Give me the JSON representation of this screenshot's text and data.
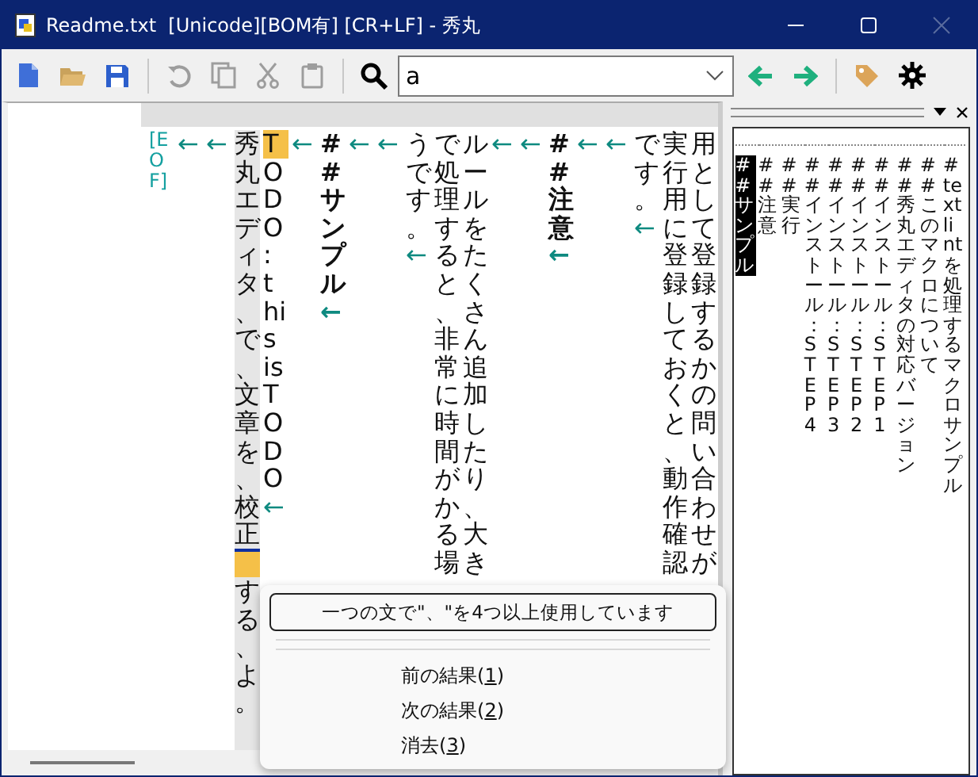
{
  "window": {
    "title": "Readme.txt  [Unicode][BOM有] [CR+LF] - 秀丸",
    "close_disabled": true
  },
  "toolbar": {
    "file_buttons": [
      {
        "kind": "new",
        "disabled": false
      },
      {
        "kind": "open",
        "disabled": false
      },
      {
        "kind": "save",
        "disabled": false
      }
    ],
    "edit_buttons": [
      {
        "kind": "undo",
        "disabled": true
      },
      {
        "kind": "copy",
        "disabled": true
      },
      {
        "kind": "cut",
        "disabled": true
      },
      {
        "kind": "paste",
        "disabled": true
      }
    ],
    "search": {
      "value": "a"
    },
    "nav_buttons": [
      {
        "kind": "back",
        "disabled": false
      },
      {
        "kind": "forward",
        "disabled": false
      }
    ],
    "tool_buttons": [
      {
        "kind": "tag",
        "disabled": false
      },
      {
        "kind": "settings",
        "disabled": false
      }
    ]
  },
  "editor": {
    "lines": [
      {
        "segments": [
          {
            "kind": "eof",
            "text": "[EOF]"
          }
        ]
      },
      {
        "eol": "←"
      },
      {
        "eol": "←"
      },
      {
        "segments": [
          {
            "kind": "text",
            "text": "秀丸エディタ、で、文章を、校正"
          },
          {
            "kind": "cursor"
          },
          {
            "kind": "text",
            "text": "する、"
          },
          {
            "kind": "text",
            "text": "よ。"
          }
        ],
        "current": true
      },
      {
        "segments": [
          {
            "kind": "mark",
            "text": "T"
          },
          {
            "kind": "text",
            "text": "ODO: this is TODO"
          }
        ],
        "eol": "←"
      },
      {
        "eol": "←"
      },
      {
        "segments": [
          {
            "kind": "text",
            "text": "## サンプル"
          }
        ],
        "bold": true,
        "eol": "←"
      },
      {
        "eol": "←"
      },
      {
        "eol": "←"
      },
      {
        "segments": [
          {
            "kind": "text",
            "text": "うです。"
          }
        ],
        "eol": "←"
      },
      {
        "segments": [
          {
            "kind": "text",
            "text": "で処理すると、非常に時間がかる場"
          }
        ]
      },
      {
        "segments": [
          {
            "kind": "text",
            "text": "ルールをたくさん追加したり、大き"
          }
        ]
      },
      {
        "eol": "←"
      },
      {
        "eol": "←"
      },
      {
        "segments": [
          {
            "kind": "text",
            "text": "## 注意"
          }
        ],
        "bold": true,
        "eol": "←"
      },
      {
        "eol": "←"
      },
      {
        "eol": "←"
      },
      {
        "segments": [
          {
            "kind": "text",
            "text": "です。"
          }
        ],
        "eol": "←"
      },
      {
        "segments": [
          {
            "kind": "text",
            "text": "実行用に登録しておくと、動作確認"
          }
        ]
      },
      {
        "segments": [
          {
            "kind": "text",
            "text": "用として登録するかの問い合わせが"
          }
        ]
      }
    ]
  },
  "outline": {
    "items": [
      {
        "label": "# textlintを処理するマクロサンプル",
        "selected": false,
        "children": [
          {
            "label": "## サンプル",
            "selected": true
          },
          {
            "label": "## 注意",
            "selected": false
          },
          {
            "label": "## 実行",
            "selected": false
          },
          {
            "label": "## インストール：STEP 4",
            "selected": false
          },
          {
            "label": "## インストール：STEP 3",
            "selected": false
          },
          {
            "label": "## インストール：STEP 2",
            "selected": false
          },
          {
            "label": "## インストール：STEP 1",
            "selected": false
          },
          {
            "label": "## 秀丸エディタの対応バージョン",
            "selected": false
          },
          {
            "label": "## このマクロについて",
            "selected": false
          }
        ]
      }
    ]
  },
  "context_menu": {
    "items": [
      {
        "kind": "message",
        "before": "一つの文で\"、\"を4つ以上使用しています",
        "selected": true
      },
      {
        "kind": "separator"
      },
      {
        "kind": "separator"
      },
      {
        "kind": "command",
        "before": "前の結果(",
        "accel": "1",
        "after": ")",
        "selected": false
      },
      {
        "kind": "command",
        "before": "次の結果(",
        "accel": "2",
        "after": ")",
        "selected": false
      },
      {
        "kind": "command",
        "before": "消去(",
        "accel": "3",
        "after": ")",
        "selected": false
      }
    ]
  }
}
